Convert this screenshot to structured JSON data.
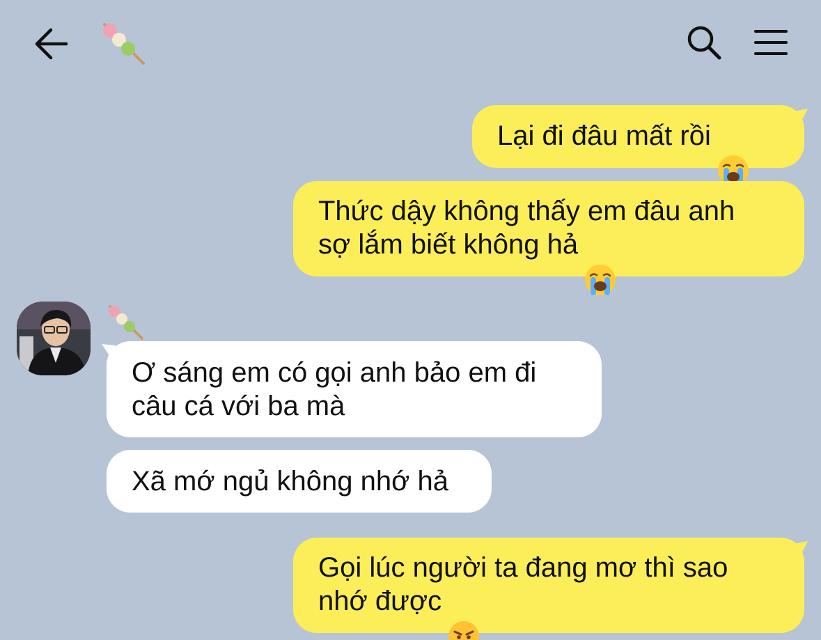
{
  "header": {
    "back_icon": "arrow-left-icon",
    "title_icon": "dango-emoji",
    "search_icon": "search-icon",
    "menu_icon": "hamburger-menu-icon"
  },
  "messages": [
    {
      "direction": "outgoing",
      "text": "Lại đi đâu mất rồi",
      "emoji": "loudly-crying-face"
    },
    {
      "direction": "outgoing",
      "text": "Thức dậy không thấy em đâu anh\nsợ lắm biết không hả",
      "emoji": "loudly-crying-face"
    },
    {
      "direction": "incoming",
      "sender_icon": "dango-emoji",
      "text": "Ơ sáng em có gọi anh bảo em đi\ncâu cá với ba mà"
    },
    {
      "direction": "incoming",
      "text": "Xã mớ ngủ không nhớ hả"
    },
    {
      "direction": "outgoing",
      "text": "Gọi lúc người ta đang mơ thì sao\nnhớ được",
      "emoji": "angry-face"
    }
  ],
  "colors": {
    "background": "#b7c4d6",
    "outgoing_bubble": "#fbee58",
    "incoming_bubble": "#ffffff",
    "text": "#111111"
  }
}
